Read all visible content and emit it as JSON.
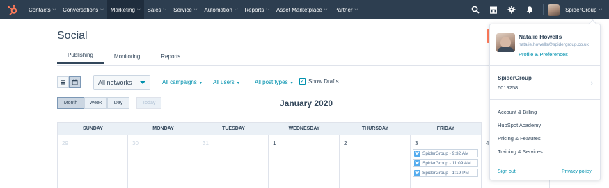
{
  "nav": {
    "items": [
      {
        "label": "Contacts"
      },
      {
        "label": "Conversations"
      },
      {
        "label": "Marketing"
      },
      {
        "label": "Sales"
      },
      {
        "label": "Service"
      },
      {
        "label": "Automation"
      },
      {
        "label": "Reports"
      },
      {
        "label": "Asset Marketplace"
      },
      {
        "label": "Partner"
      }
    ],
    "active_item": "Marketing",
    "account_name": "SpiderGroup"
  },
  "page": {
    "title": "Social",
    "tabs": [
      {
        "label": "Publishing",
        "active": true
      },
      {
        "label": "Monitoring",
        "active": false
      },
      {
        "label": "Reports",
        "active": false
      }
    ]
  },
  "filters": {
    "networks": "All networks",
    "campaigns": "All campaigns",
    "users": "All users",
    "post_types": "All post types",
    "show_drafts_label": "Show Drafts",
    "show_drafts_checked": true
  },
  "calendar": {
    "range_buttons": [
      {
        "label": "Month",
        "active": true
      },
      {
        "label": "Week",
        "active": false
      },
      {
        "label": "Day",
        "active": false
      }
    ],
    "today_label": "Today",
    "month_title": "January 2020",
    "weekdays": [
      "SUNDAY",
      "MONDAY",
      "TUESDAY",
      "WEDNESDAY",
      "THURSDAY",
      "FRIDAY"
    ],
    "dates": [
      {
        "num": "29",
        "muted": true
      },
      {
        "num": "30",
        "muted": true
      },
      {
        "num": "31",
        "muted": true
      },
      {
        "num": "1",
        "muted": false
      },
      {
        "num": "2",
        "muted": false
      },
      {
        "num": "3",
        "muted": false
      },
      {
        "num": "4",
        "muted": false
      }
    ],
    "posts": [
      {
        "label": "SpiderGroup - 9:32 AM"
      },
      {
        "label": "SpiderGroup - 11:09 AM"
      },
      {
        "label": "SpiderGroup - 1:19 PM"
      }
    ]
  },
  "dropdown": {
    "user_name": "Natalie Howells",
    "user_email": "natalie.howells@spidergroup.co.uk",
    "profile_link": "Profile & Preferences",
    "company": "SpiderGroup",
    "hub_id": "6019258",
    "menu": [
      {
        "label": "Account & Billing"
      },
      {
        "label": "HubSpot Academy"
      },
      {
        "label": "Pricing & Features"
      },
      {
        "label": "Training & Services"
      }
    ],
    "sign_out": "Sign out",
    "privacy": "Privacy policy"
  },
  "colors": {
    "nav_bg": "#2d3e50",
    "accent": "#0091ae",
    "brand_orange": "#ff7a59",
    "twitter": "#55acee"
  },
  "icons": [
    "hubspot-logo-icon",
    "search-icon",
    "marketplace-icon",
    "gear-icon",
    "bell-icon",
    "list-view-icon",
    "calendar-view-icon",
    "twitter-icon",
    "chevron-right-icon"
  ]
}
